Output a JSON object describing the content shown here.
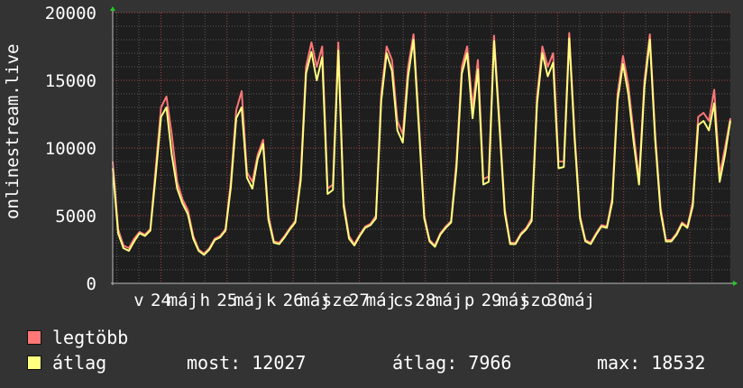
{
  "chart_data": {
    "type": "line",
    "ylabel": "onlinestream.live",
    "ylim": [
      0,
      20000
    ],
    "yticks": [
      0,
      5000,
      10000,
      15000,
      20000
    ],
    "yticklabels": [
      "0",
      "5000",
      "10000",
      "15000",
      "20000"
    ],
    "grid": true,
    "x_start": "máj 23 12:00",
    "x_step_hours": 3,
    "xtick_labels": [
      "v",
      "24",
      "máj",
      "h",
      "25",
      "máj",
      "k",
      "26",
      "máj",
      "sze",
      "27",
      "máj",
      "cs",
      "28",
      "máj",
      "p",
      "29",
      "máj",
      "szo",
      "30",
      "máj"
    ],
    "series": [
      {
        "name": "legtöbb",
        "color": "#ff7777",
        "values": [
          9000,
          4000,
          2800,
          2600,
          3300,
          3800,
          3600,
          4000,
          8500,
          13000,
          13800,
          11000,
          7500,
          6200,
          5400,
          3500,
          2500,
          2200,
          2600,
          3300,
          3500,
          4000,
          7500,
          12800,
          14200,
          8200,
          7500,
          9500,
          10600,
          5000,
          3100,
          3000,
          3500,
          4100,
          4600,
          8000,
          16000,
          17800,
          16000,
          17500,
          7000,
          7300,
          17800,
          6000,
          3500,
          2900,
          3600,
          4200,
          4400,
          5000,
          14000,
          17500,
          16500,
          12000,
          11000,
          16000,
          18400,
          12000,
          5000,
          3200,
          2800,
          3700,
          4200,
          4600,
          9000,
          16000,
          17500,
          13000,
          16500,
          7700,
          7900,
          18300,
          12000,
          5500,
          3000,
          3000,
          3700,
          4100,
          4800,
          13800,
          17500,
          16000,
          17000,
          9000,
          9000,
          18500,
          11000,
          5000,
          3200,
          3000,
          3700,
          4300,
          4200,
          6300,
          14000,
          16800,
          14700,
          11000,
          7700,
          15000,
          18400,
          11000,
          5600,
          3200,
          3200,
          3700,
          4500,
          4200,
          6000,
          12300,
          12600,
          12000,
          14300,
          8000,
          10000,
          12200
        ]
      },
      {
        "name": "átlag",
        "color": "#ffff80",
        "values": [
          8500,
          3700,
          2600,
          2400,
          3100,
          3700,
          3500,
          3900,
          8000,
          12300,
          13000,
          9500,
          7000,
          5900,
          5100,
          3300,
          2400,
          2100,
          2500,
          3200,
          3400,
          3900,
          7100,
          12200,
          13000,
          7800,
          7000,
          9200,
          10300,
          4700,
          3000,
          2900,
          3400,
          4000,
          4500,
          7600,
          15500,
          17100,
          15000,
          16700,
          6600,
          6900,
          17200,
          5700,
          3300,
          2800,
          3500,
          4100,
          4300,
          4800,
          13500,
          17000,
          15700,
          11300,
          10400,
          15300,
          18000,
          11500,
          4800,
          3100,
          2700,
          3600,
          4100,
          4500,
          8500,
          15500,
          17000,
          12200,
          15800,
          7300,
          7500,
          17900,
          11600,
          5200,
          2900,
          2900,
          3600,
          4000,
          4600,
          13300,
          17000,
          15300,
          16300,
          8500,
          8600,
          18100,
          10600,
          4800,
          3100,
          2900,
          3600,
          4200,
          4100,
          6000,
          13500,
          16200,
          14000,
          10400,
          7300,
          14500,
          18000,
          10600,
          5300,
          3100,
          3100,
          3600,
          4400,
          4100,
          5700,
          11700,
          12000,
          11300,
          13300,
          7500,
          9500,
          12027
        ]
      }
    ]
  },
  "legend": {
    "max_label": "legtöbb",
    "avg_label": "átlag",
    "max_color": "#ff7777",
    "avg_color": "#ffff80"
  },
  "stats": {
    "current": "most: 12027",
    "average": "átlag: 7966",
    "maximum": "max: 18532"
  }
}
